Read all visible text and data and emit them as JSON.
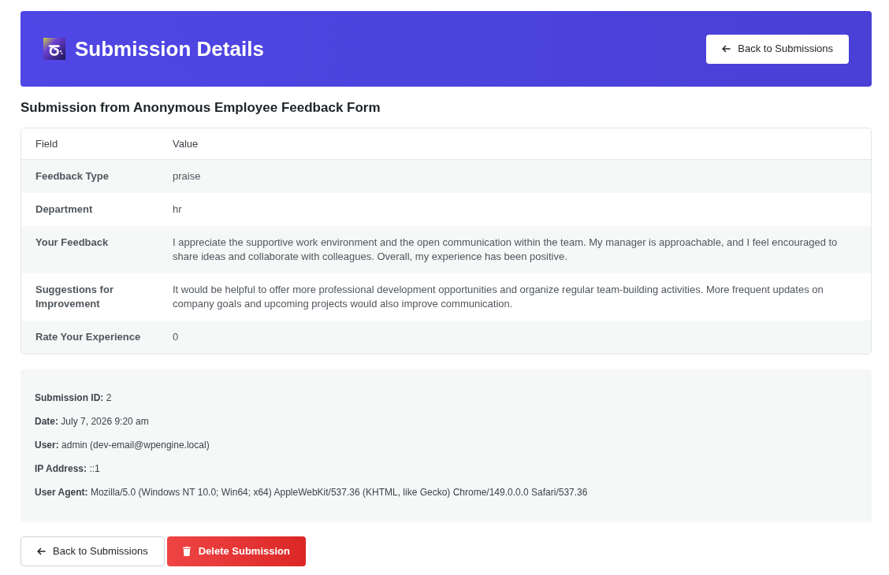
{
  "header": {
    "title": "Submission Details",
    "back_button": "Back to Submissions"
  },
  "form_title": "Submission from Anonymous Employee Feedback Form",
  "table": {
    "columns": [
      "Field",
      "Value"
    ],
    "rows": [
      {
        "field": "Feedback Type",
        "value": "praise"
      },
      {
        "field": "Department",
        "value": "hr"
      },
      {
        "field": "Your Feedback",
        "value": "I appreciate the supportive work environment and the open communication within the team. My manager is approachable, and I feel encouraged to share ideas and collaborate with colleagues. Overall, my experience has been positive."
      },
      {
        "field": "Suggestions for Improvement",
        "value": "It would be helpful to offer more professional development opportunities and organize regular team-building activities. More frequent updates on company goals and upcoming projects would also improve communication."
      },
      {
        "field": "Rate Your Experience",
        "value": "0"
      }
    ]
  },
  "meta": [
    {
      "label": "Submission ID:",
      "value": "2"
    },
    {
      "label": "Date:",
      "value": "July 7, 2026 9:20 am"
    },
    {
      "label": "User:",
      "value": "admin (dev-email@wpengine.local)"
    },
    {
      "label": "IP Address:",
      "value": "::1"
    },
    {
      "label": "User Agent:",
      "value": "Mozilla/5.0 (Windows NT 10.0; Win64; x64) AppleWebKit/537.36 (KHTML, like Gecko) Chrome/149.0.0.0 Safari/537.36"
    }
  ],
  "actions": [
    {
      "kind": "secondary",
      "label": "Back to Submissions"
    },
    {
      "kind": "danger",
      "label": "Delete Submission"
    }
  ]
}
